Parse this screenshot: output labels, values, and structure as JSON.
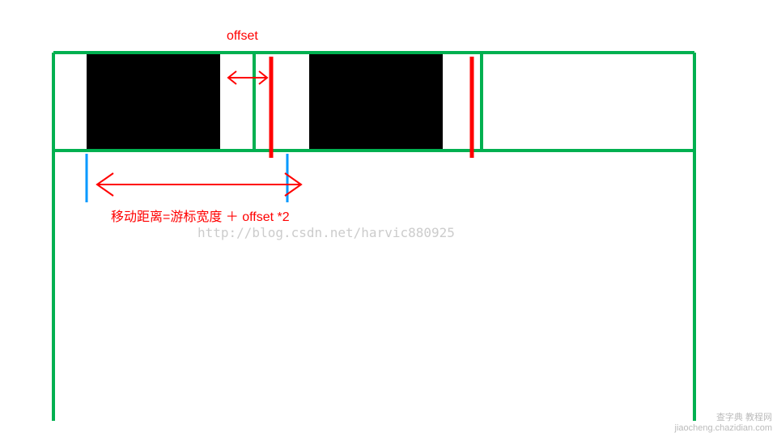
{
  "labels": {
    "offset": "offset",
    "moveDistance": "移动距离=游标宽度 ＋ offset *2"
  },
  "watermark": {
    "url": "http://blog.csdn.net/harvic880925",
    "cornerLine1": "查字典 教程网",
    "cornerLine2": "jiaocheng.chazidian.com"
  },
  "colors": {
    "green": "#00b050",
    "red": "#ff0000",
    "blue": "#0099ff",
    "black": "#000000"
  },
  "geometry": {
    "outerLeft": 66,
    "outerRight": 858,
    "tabTop": 65,
    "tabBottom": 186,
    "containerBottom": 520,
    "tabWidth": 248,
    "cursor1Left": 107,
    "cursorWidth": 165,
    "gap": 54,
    "blueY1": 186,
    "blueY2": 250,
    "blueLeftX": 107,
    "blueRightX": 355
  }
}
